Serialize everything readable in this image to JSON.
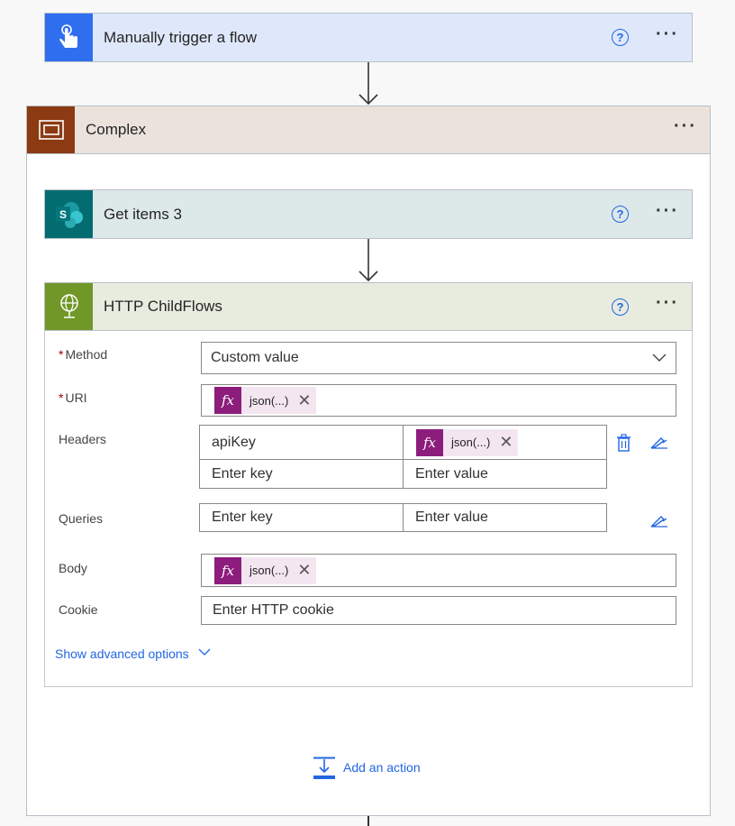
{
  "trigger": {
    "title": "Manually trigger a flow",
    "help": "?",
    "more": "···"
  },
  "scope": {
    "title": "Complex",
    "more": "···"
  },
  "get_items": {
    "title": "Get items 3",
    "help": "?",
    "more": "···"
  },
  "http": {
    "title": "HTTP ChildFlows",
    "help": "?",
    "more": "···",
    "method_label": "Method",
    "method_value": "Custom value",
    "uri_label": "URI",
    "uri_token": "json(...)",
    "headers_label": "Headers",
    "header_key": "apiKey",
    "header_value_token": "json(...)",
    "header_key_placeholder": "Enter key",
    "header_value_placeholder": "Enter value",
    "queries_label": "Queries",
    "query_key_placeholder": "Enter key",
    "query_value_placeholder": "Enter value",
    "body_label": "Body",
    "body_token": "json(...)",
    "cookie_label": "Cookie",
    "cookie_placeholder": "Enter HTTP cookie",
    "advanced": "Show advanced options"
  },
  "add_action": "Add an action",
  "required_mark": "*",
  "token_fx": "fx",
  "token_remove": "✕",
  "colors": {
    "trigger_icon": "#2f6fef",
    "trigger_bar": "#dfe8fb",
    "scope_icon": "#8b3a12",
    "scope_bar": "#ebe2dc",
    "sp_icon": "#036c70",
    "sp_bar": "#dde8e9",
    "http_icon": "#709727",
    "http_bar": "#e8ecdf",
    "token_fx": "#8d1d7c",
    "link": "#2266e3"
  }
}
